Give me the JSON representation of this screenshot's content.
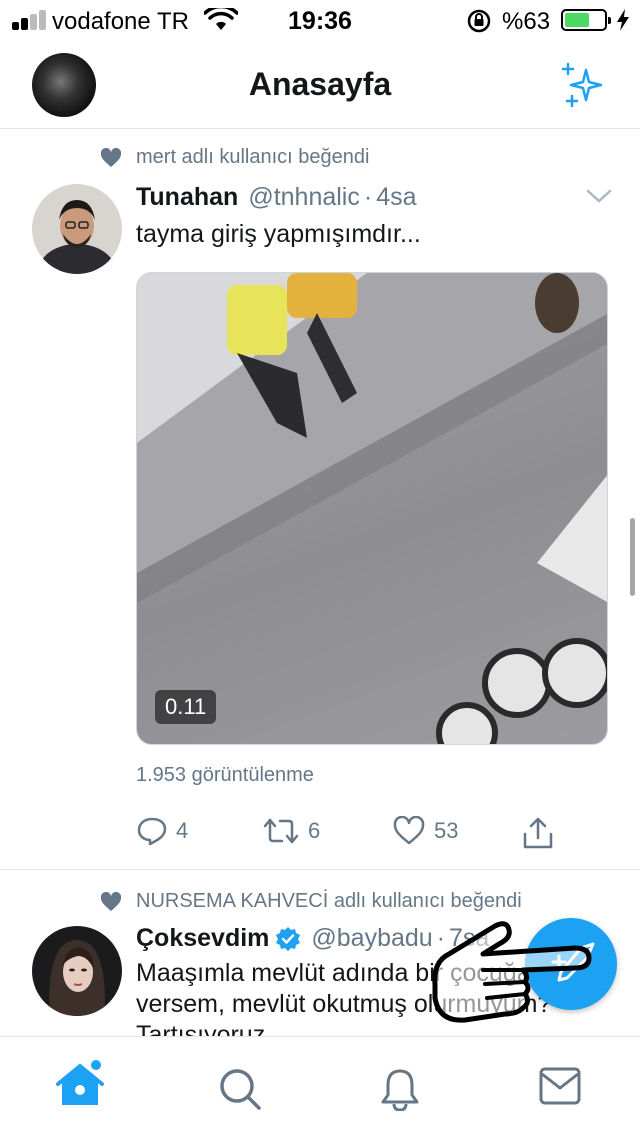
{
  "status_bar": {
    "carrier": "vodafone TR",
    "time": "19:36",
    "battery_percent": "%63",
    "battery_level": 0.63,
    "signal_bars": 2
  },
  "header": {
    "title": "Anasayfa",
    "profile_icon": "profile-avatar",
    "timeline_icon": "sparkle-icon"
  },
  "feed": [
    {
      "social_context": "mert adlı kullanıcı beğendi",
      "name": "Tunahan",
      "handle": "@tnhnalic",
      "separator": "·",
      "time": "4sa",
      "text": "tayma giriş yapmışımdır...",
      "media": {
        "type": "video",
        "duration": "0.11"
      },
      "views": "1.953 görüntülenme",
      "actions": {
        "replies": "4",
        "retweets": "6",
        "likes": "53"
      }
    },
    {
      "social_context": "NURSEMA KAHVECİ adlı kullanıcı beğendi",
      "name": "Çoksevdim",
      "verified": true,
      "handle": "@baybadu",
      "separator": "·",
      "time": "7sa",
      "text": "Maaşımla mevlüt adında bir çocuğa burs versem, mevlüt okutmuş olurmuyum? Tartışıyoruz"
    }
  ],
  "compose_button": {
    "icon": "compose-tweet-icon"
  },
  "tab_bar": {
    "tabs": [
      "home-icon",
      "search-icon",
      "notifications-icon",
      "messages-icon"
    ],
    "active": "home-icon"
  },
  "colors": {
    "accent": "#1da1f2",
    "secondary_text": "#657786",
    "battery": "#4cd964"
  }
}
